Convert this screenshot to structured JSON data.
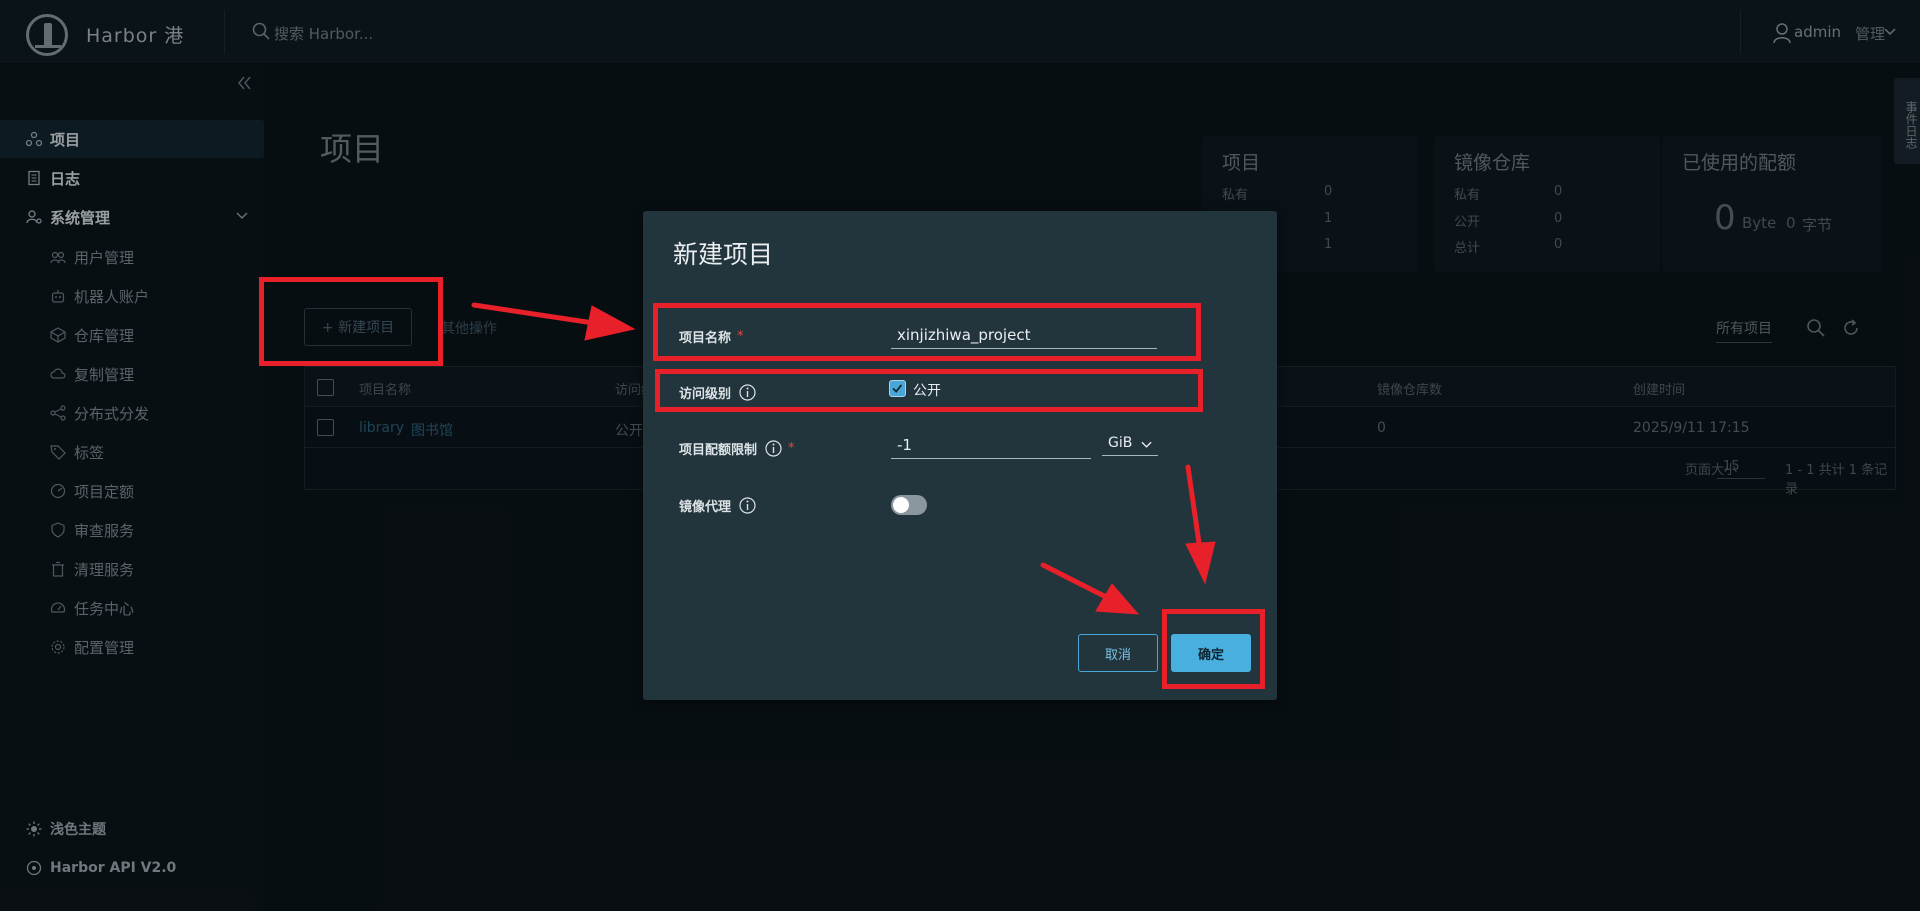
{
  "header": {
    "brand": "Harbor 港",
    "search_placeholder": "搜索 Harbor...",
    "user_name": "admin",
    "user_role": "管理"
  },
  "sidebar": {
    "items": [
      {
        "label": "项目",
        "icon": "project-icon",
        "active": true
      },
      {
        "label": "日志",
        "icon": "log-icon"
      },
      {
        "label": "系统管理",
        "icon": "admin-icon"
      }
    ],
    "subitems": [
      {
        "label": "用户管理",
        "icon": "users-icon"
      },
      {
        "label": "机器人账户",
        "icon": "robot-icon"
      },
      {
        "label": "仓库管理",
        "icon": "registry-icon"
      },
      {
        "label": "复制管理",
        "icon": "replication-icon"
      },
      {
        "label": "分布式分发",
        "icon": "distribution-icon"
      },
      {
        "label": "标签",
        "icon": "tag-icon"
      },
      {
        "label": "项目定额",
        "icon": "quota-icon"
      },
      {
        "label": "审查服务",
        "icon": "shield-icon"
      },
      {
        "label": "清理服务",
        "icon": "trash-icon"
      },
      {
        "label": "任务中心",
        "icon": "dashboard-icon"
      },
      {
        "label": "配置管理",
        "icon": "gear-icon"
      }
    ],
    "footer": [
      {
        "label": "浅色主题",
        "icon": "sun-icon"
      },
      {
        "label": "Harbor API V2.0",
        "icon": "api-icon"
      }
    ]
  },
  "page": {
    "title": "项目",
    "new_project_label": "+ 新建项目",
    "more_ops_label": "其他操作",
    "filter_label": "所有项目"
  },
  "summary": {
    "projects": {
      "title": "项目",
      "rows": [
        {
          "label": "私有",
          "value": "0"
        },
        {
          "label": "",
          "value": "1"
        },
        {
          "label": "",
          "value": "1"
        }
      ]
    },
    "repos": {
      "title": "镜像仓库",
      "rows": [
        {
          "label": "私有",
          "value": "0"
        },
        {
          "label": "公开",
          "value": "0"
        },
        {
          "label": "总计",
          "value": "0"
        }
      ]
    },
    "quota": {
      "title": "已使用的配额",
      "value": "0",
      "unit_en": "Byte",
      "value2": "0",
      "unit_cn": "字节"
    }
  },
  "table": {
    "headers": [
      "项目名称",
      "访问级别",
      "镜像仓库数",
      "创建时间"
    ],
    "rows": [
      {
        "name": "library",
        "name_badge": "图书馆",
        "access": "公开",
        "repo_count": "0",
        "created": "2025/9/11 17:15"
      }
    ],
    "page_size_label": "页面大小",
    "page_size": "15",
    "record_info": "1 - 1 共计 1 条记录"
  },
  "side_tab": "事件日志",
  "modal": {
    "title": "新建项目",
    "name_label": "项目名称",
    "name_value": "xinjizhiwa_project",
    "access_label": "访问级别",
    "public_label": "公开",
    "public_checked": true,
    "quota_label": "项目配额限制",
    "quota_value": "-1",
    "quota_unit": "GiB",
    "proxy_label": "镜像代理",
    "proxy_enabled": false,
    "cancel_label": "取消",
    "ok_label": "确定"
  },
  "colors": {
    "accent": "#49afdf",
    "annotation": "#e8202a"
  }
}
